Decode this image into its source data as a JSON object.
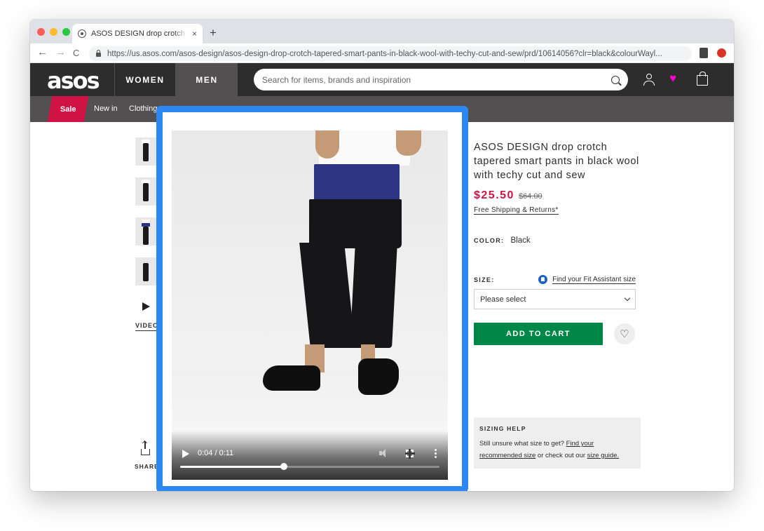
{
  "browser": {
    "tab_title": "ASOS DESIGN drop crotch tapered smart pants",
    "tab_close": "×",
    "new_tab": "+",
    "back": "←",
    "forward": "→",
    "reload": "C",
    "url": "https://us.asos.com/asos-design/asos-design-drop-crotch-tapered-smart-pants-in-black-wool-with-techy-cut-and-sew/prd/10614056?clr=black&colourWayl...",
    "traffic_lights": [
      "#ff5f57",
      "#febc2e",
      "#28c840"
    ]
  },
  "header": {
    "logo": "asos",
    "nav": [
      "WOMEN",
      "MEN"
    ],
    "search_placeholder": "Search for items, brands and inspiration",
    "icons": [
      "account-icon",
      "saved-items-icon",
      "bag-icon"
    ],
    "heart_glyph": "♥"
  },
  "category_nav": {
    "sale": "Sale",
    "items": [
      "New in",
      "Clothing"
    ]
  },
  "gallery": {
    "thumbnails": 4,
    "video_label": "VIDEO",
    "share_label": "SHARE"
  },
  "video": {
    "time": "0:04 / 0:11",
    "progress": 0.4
  },
  "product": {
    "title": "ASOS DESIGN drop crotch tapered smart pants in black wool with techy cut and sew",
    "price": "$25.50",
    "was_price": "$64.00",
    "shipping": "Free Shipping & Returns*",
    "color_label": "COLOR:",
    "color_value": "Black",
    "size_label": "SIZE:",
    "fit_assistant": "Find your Fit Assistant size",
    "size_select": "Please select",
    "add_to_cart": "ADD TO CART",
    "save_glyph": "♡"
  },
  "sizing_help": {
    "title": "SIZING HELP",
    "text_1": "Still unsure what size to get?",
    "link_1": "Find your recommended size",
    "text_2": "or check out our",
    "link_2": "size guide."
  },
  "colors": {
    "accent_blue": "#2b87f1",
    "sale_red": "#d01345",
    "add_green": "#018849",
    "header_dark": "#2d2d2d"
  }
}
